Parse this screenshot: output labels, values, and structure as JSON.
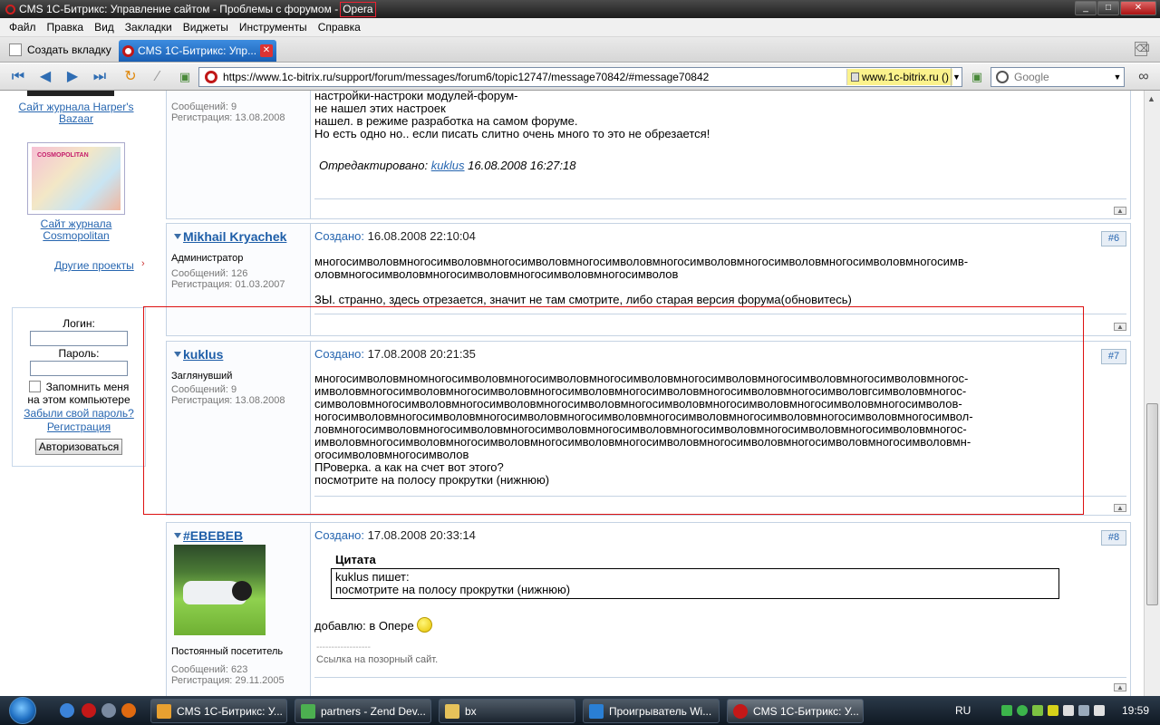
{
  "window": {
    "title_main": "CMS 1С-Битрикс: Управление сайтом - Проблемы с форумом -",
    "title_app": "Opera",
    "min": "_",
    "max": "□",
    "close": "✕"
  },
  "menu": [
    "Файл",
    "Правка",
    "Вид",
    "Закладки",
    "Виджеты",
    "Инструменты",
    "Справка"
  ],
  "tabs": {
    "new_tab": "Создать вкладку",
    "active_tab": "CMS 1С-Битрикс: Упр...",
    "close": "✕"
  },
  "nav": {
    "url": "https://www.1c-bitrix.ru/support/forum/messages/forum6/topic12747/message70842/#message70842",
    "security": "www.1c-bitrix.ru ()",
    "search_placeholder": "Google",
    "dd": "▼"
  },
  "sidebar": {
    "link1_line1": "Сайт журнала Harper's",
    "link1_line2": "Bazaar",
    "thumb_logo": "COSMOPOLITAN",
    "link2_line1": "Сайт журнала",
    "link2_line2": "Cosmopolitan",
    "other_projects": "Другие проекты",
    "arrow": "›",
    "login_label": "Логин:",
    "password_label": "Пароль:",
    "remember_line1": "Запомнить меня",
    "remember_line2": "на этом компьютере",
    "forgot": "Забыли свой пароль?",
    "register": "Регистрация",
    "auth_btn": "Авторизоваться"
  },
  "posts": [
    {
      "meta_count": "Сообщений: 9",
      "meta_reg": "Регистрация: 13.08.2008",
      "body": "настройки-настроки модулей-форум-\nне нашел этих настроек\nнашел. в режиме разработка на самом форуме.\nНо есть одно но.. если писать слитно очень много то это не обрезается!",
      "edited_label": "Отредактировано:",
      "edited_user": "kuklus",
      "edited_date": "16.08.2008 16:27:18"
    },
    {
      "author": "Mikhail Kryachek",
      "role": "Администратор",
      "meta_count": "Сообщений: 126",
      "meta_reg": "Регистрация: 01.03.2007",
      "created_label": "Создано:",
      "created_date": "16.08.2008 22:10:04",
      "num": "#6",
      "body": "многосимволовмногосимволовмногосимволовмногосимволовмногосимволовмногосимволовмногосимволовмногосимв-\nоловмногосимволовмногосимволовмногосимволовмногосимволов\n\nЗЫ. странно, здесь отрезается, значит не там смотрите, либо старая версия форума(обновитесь)"
    },
    {
      "author": "kuklus",
      "role": "Заглянувший",
      "meta_count": "Сообщений: 9",
      "meta_reg": "Регистрация: 13.08.2008",
      "created_label": "Создано:",
      "created_date": "17.08.2008 20:21:35",
      "num": "#7",
      "body": "многосимволовмномногосимволовмногосимволовмногосимволовмногосимволовмногосимволовмногосимволовмногос-\nимволовмногосимволовмногосимволовмногосимволовмногосимволовмногосимволовмногосимволовгсимволовмногос-\nсимволовмногосимволовмногосимволовмногосимволовмногосимволовмногосимволовмногосимволовмногосимволов-\nногосимволовмногосимволовмногосимволовмногосимволовмногосимволовмногосимволовмногосимволовмногосимвол-\nловмногосимволовмногосимволовмногосимволовмногосимволовмногосимволовмногосимволовмногосимволовмногос-\nимволовмногосимволовмногосимволовмногосимволовмногосимволовмногосимволовмногосимволовмногосимволовмн-\nогосимволовмногосимволов\nПРоверка. а как на счет вот этого?\nпосмотрите на полосу прокрутки (нижнюю)"
    },
    {
      "author": "#EBEBEB",
      "role": "Постоянный посетитель",
      "meta_count": "Сообщений: 623",
      "meta_reg": "Регистрация: 29.11.2005",
      "created_label": "Создано:",
      "created_date": "17.08.2008 20:33:14",
      "num": "#8",
      "quote_title": "Цитата",
      "quote_line1": "kuklus пишет:",
      "quote_line2": "посмотрите на полосу прокрутки (нижнюю)",
      "body": "добавлю: в Опере",
      "sig_dashes": "------------------",
      "sig": "Ссылка на позорный сайт."
    }
  ],
  "up_arrow": "▲",
  "taskbar": {
    "items": [
      "CMS 1С-Битрикс: У...",
      "partners - Zend Dev...",
      "bx",
      "Проигрыватель Wi...",
      "CMS 1С-Битрикс: У..."
    ],
    "lang": "RU",
    "clock": "19:59"
  },
  "colors": {
    "accent": "#2766b0",
    "highlight_border": "#dd1111",
    "security_bg": "#fbf28c"
  }
}
